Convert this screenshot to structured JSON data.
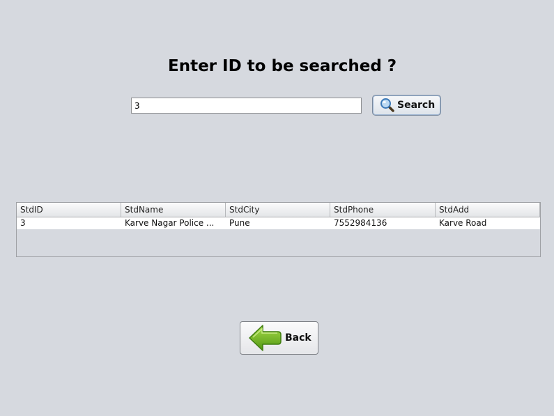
{
  "heading": "Enter ID to be searched ?",
  "search": {
    "value": "3",
    "button_label": "Search",
    "button_icon": "magnifier-icon"
  },
  "table": {
    "columns": [
      "StdID",
      "StdName",
      "StdCity",
      "StdPhone",
      "StdAdd"
    ],
    "rows": [
      [
        "3",
        "Karve Nagar Police ...",
        "Pune",
        "7552984136",
        "Karve Road"
      ]
    ]
  },
  "back": {
    "button_label": "Back",
    "button_icon": "left-arrow-icon",
    "icon_color": "#6fb01f"
  }
}
